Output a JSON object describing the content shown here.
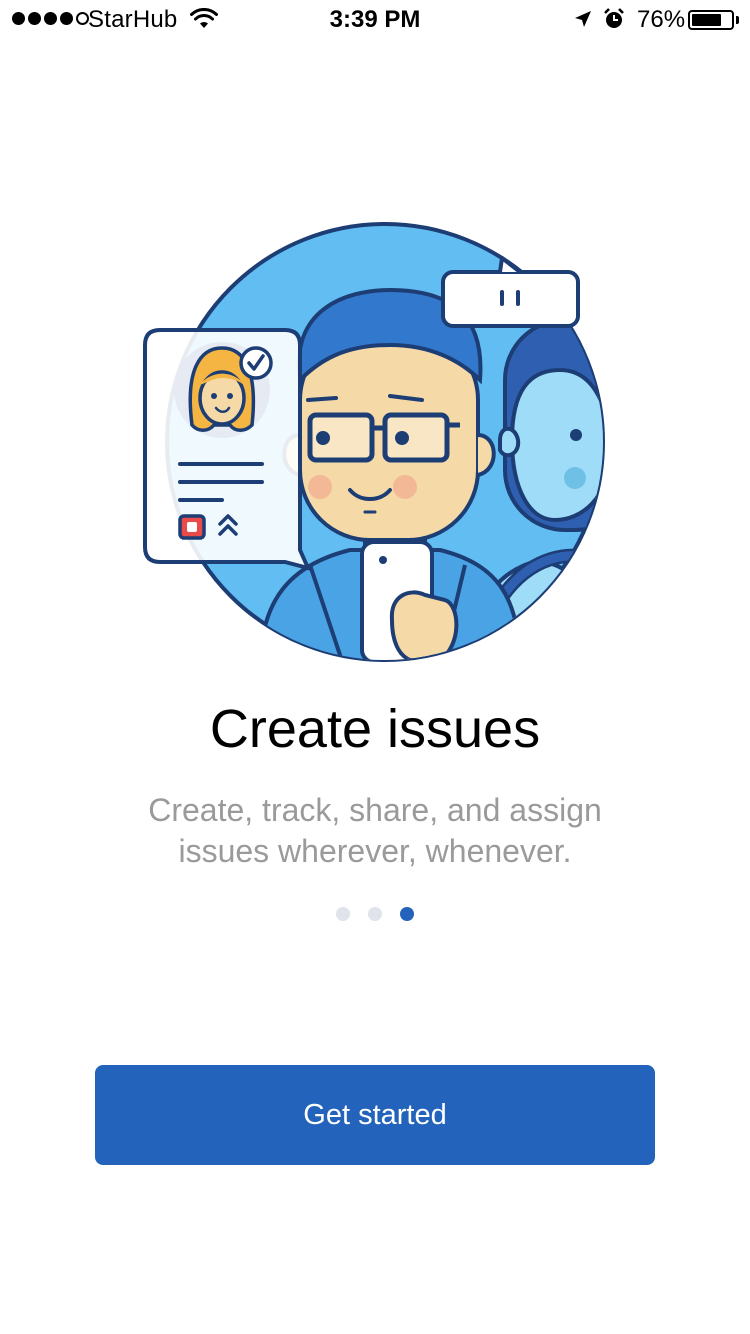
{
  "status_bar": {
    "carrier": "StarHub",
    "time": "3:39 PM",
    "battery_percent": "76%",
    "battery_level": 0.76,
    "signal_bars_filled": 4,
    "signal_bars_total": 5
  },
  "onboarding": {
    "title": "Create issues",
    "subtitle": "Create, track, share, and assign issues wherever, whenever.",
    "page_count": 3,
    "active_page": 3
  },
  "actions": {
    "get_started_label": "Get started"
  },
  "colors": {
    "accent": "#2463bb",
    "inactive_dot": "#dfe3ea",
    "subtitle_text": "#9a9a9a"
  },
  "icons": [
    "wifi-icon",
    "location-arrow-icon",
    "alarm-icon",
    "battery-icon",
    "checkmark-icon",
    "priority-chevron-icon"
  ]
}
